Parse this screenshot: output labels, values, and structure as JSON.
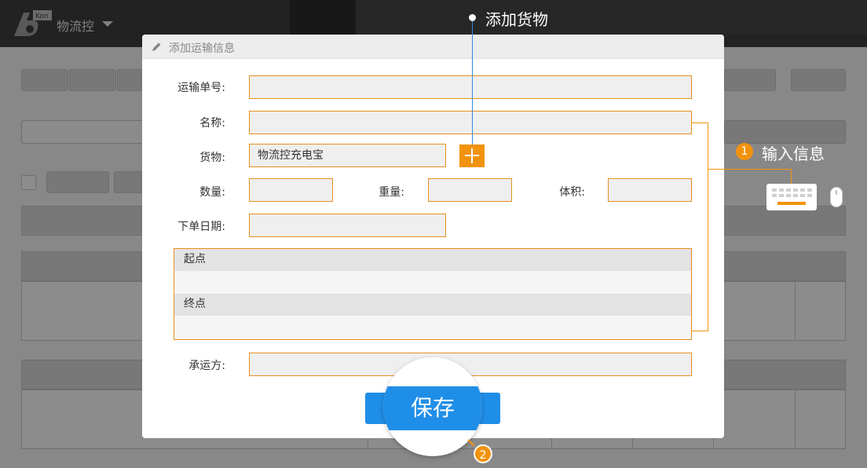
{
  "app": {
    "name": "物流控",
    "logo_badge": "Kon"
  },
  "modal": {
    "title": "添加运输信息",
    "fields": {
      "waybill_label": "运输单号:",
      "waybill_value": "",
      "name_label": "名称:",
      "name_value": "",
      "cargo_label": "货物:",
      "cargo_value": "物流控充电宝",
      "quantity_label": "数量:",
      "weight_label": "重量:",
      "volume_label": "体积:",
      "order_date_label": "下单日期:",
      "carrier_label": "承运方:"
    },
    "route": {
      "start_label": "起点",
      "end_label": "终点"
    },
    "save_label": "保存"
  },
  "annotations": {
    "add_cargo": "添加货物",
    "input_info": "输入信息",
    "step1": "1",
    "step2": "2",
    "magnified_save": "保存"
  },
  "colors": {
    "accent_orange": "#f2930f",
    "primary_blue": "#1f8ee8",
    "callout_blue": "#2d8be0"
  },
  "icons": [
    "logo-icon",
    "chevron-down-icon",
    "pencil-icon",
    "plus-icon",
    "keyboard-icon",
    "mouse-icon"
  ]
}
